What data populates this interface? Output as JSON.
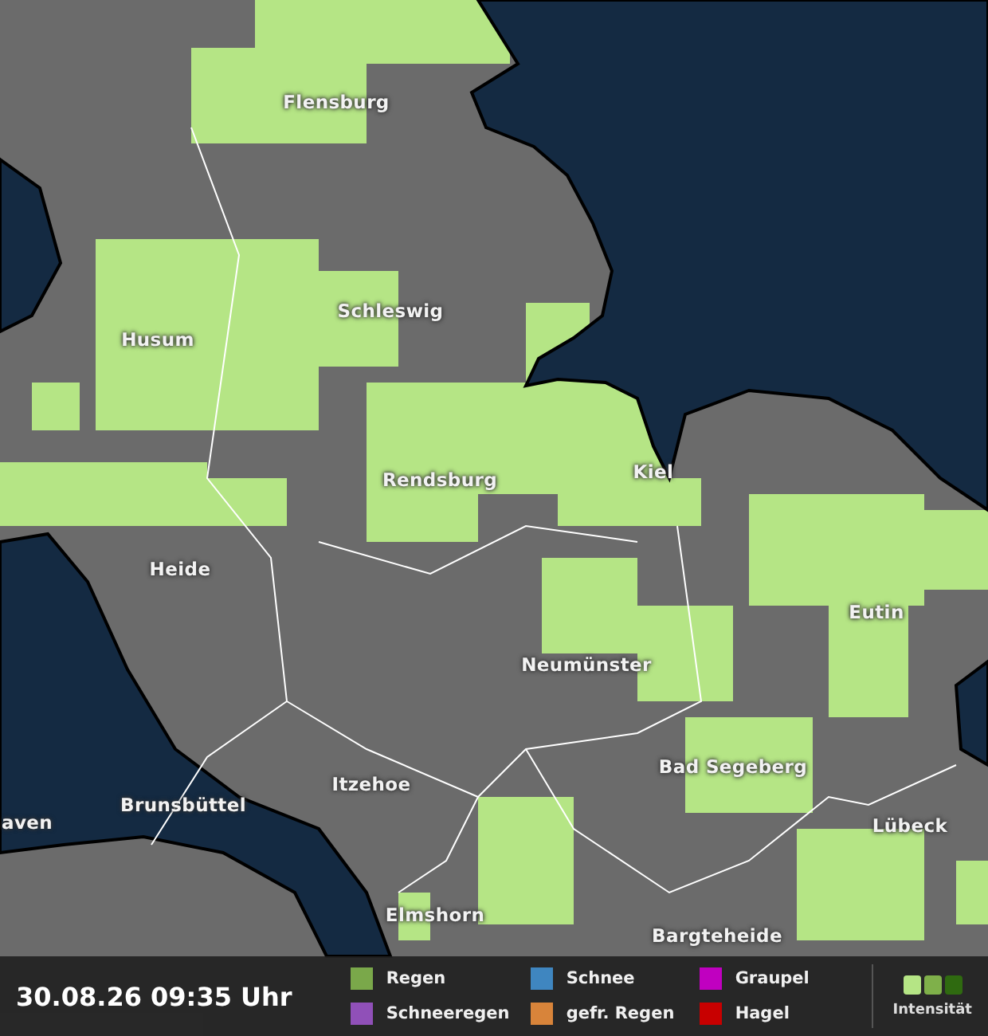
{
  "map": {
    "places": [
      {
        "name": "Flensburg"
      },
      {
        "name": "Schleswig"
      },
      {
        "name": "Husum"
      },
      {
        "name": "Rendsburg"
      },
      {
        "name": "Kiel"
      },
      {
        "name": "Heide"
      },
      {
        "name": "Eutin"
      },
      {
        "name": "Neumünster"
      },
      {
        "name": "Bad Segeberg"
      },
      {
        "name": "Itzehoe"
      },
      {
        "name": "Brunsbüttel"
      },
      {
        "name": "aven"
      },
      {
        "name": "Lübeck"
      },
      {
        "name": "Elmshorn"
      },
      {
        "name": "Bargteheide"
      }
    ]
  },
  "legend": {
    "timestamp": "30.08.26 09:35 Uhr",
    "items": [
      {
        "label": "Regen",
        "color": "#7aa84a"
      },
      {
        "label": "Schnee",
        "color": "#3f86c0"
      },
      {
        "label": "Graupel",
        "color": "#c000c0"
      },
      {
        "label": "Schneeregen",
        "color": "#9050b8"
      },
      {
        "label": "gefr. Regen",
        "color": "#d8843a"
      },
      {
        "label": "Hagel",
        "color": "#c80000"
      }
    ],
    "intensity": {
      "label": "Intensität",
      "levels": [
        {
          "color": "#b5e585"
        },
        {
          "color": "#7fb04a"
        },
        {
          "color": "#2f6a10"
        }
      ]
    }
  }
}
